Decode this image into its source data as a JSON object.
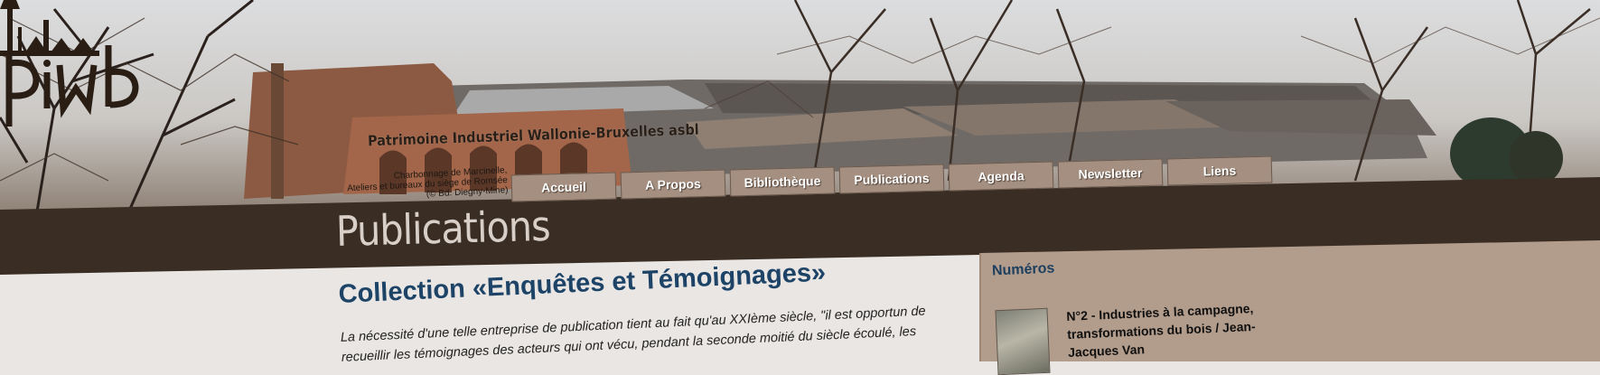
{
  "header": {
    "logo_text": "piwb",
    "logo_tagline": "Patrimoine Industriel Wallonie-Bruxelles asbl",
    "photo_caption": [
      "Charbonnage de Marcinelle,",
      "Ateliers et bureaux du siège de Romsée",
      "(© Bd. Diegny-Mine)"
    ]
  },
  "nav": {
    "items": [
      {
        "label": "Accueil"
      },
      {
        "label": "A Propos"
      },
      {
        "label": "Bibliothèque"
      },
      {
        "label": "Publications"
      },
      {
        "label": "Agenda"
      },
      {
        "label": "Newsletter"
      },
      {
        "label": "Liens"
      }
    ]
  },
  "page": {
    "title": "Publications"
  },
  "main": {
    "heading": "Collection «Enquêtes et Témoignages»",
    "intro": "La nécessité d'une telle entreprise de publication tient au fait qu'au XXIème siècle, \"il est opportun de recueillir les témoignages des acteurs qui ont vécu, pendant la seconde moitié du siècle écoulé, les"
  },
  "sidebar": {
    "heading": "Numéros",
    "items": [
      {
        "title": "N°2 - Industries à la campagne, transformations du bois / Jean-Jacques Van"
      }
    ]
  },
  "colors": {
    "band": "#3a2d24",
    "sidebar_bg": "#b29c8b",
    "nav_tab": "#a48f80",
    "heading_blue": "#1d4367"
  }
}
